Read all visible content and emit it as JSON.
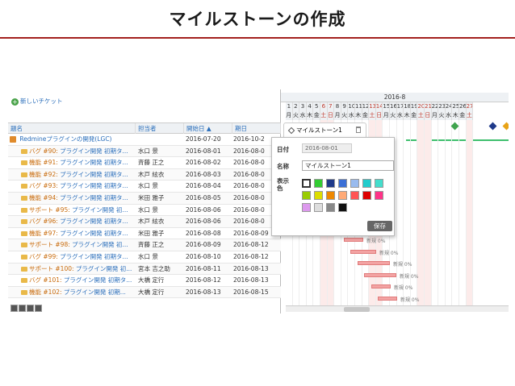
{
  "slide": {
    "title": "マイルストーンの作成"
  },
  "toolbar": {
    "new_ticket": "新しいチケット"
  },
  "table": {
    "headers": {
      "subject": "題名",
      "assignee": "担当者",
      "start": "開始日 ▲",
      "due": "期日"
    },
    "rows": [
      {
        "tracker": "",
        "subject": "Redmineプラグインの開発(LGC)",
        "assignee": "",
        "start": "2016-07-20",
        "due": "2016-10-2"
      },
      {
        "tracker": "バグ #90:",
        "subject": "プラグイン開発 初期タ...",
        "assignee": "水口 景",
        "start": "2016-08-01",
        "due": "2016-08-0"
      },
      {
        "tracker": "機能 #91:",
        "subject": "プラグイン開発 初期タ...",
        "assignee": "斉藤 正之",
        "start": "2016-08-02",
        "due": "2016-08-0"
      },
      {
        "tracker": "機能 #92:",
        "subject": "プラグイン開発 初期タ...",
        "assignee": "木戸 絃衣",
        "start": "2016-08-03",
        "due": "2016-08-0"
      },
      {
        "tracker": "バグ #93:",
        "subject": "プラグイン開発 初期タ...",
        "assignee": "水口 景",
        "start": "2016-08-04",
        "due": "2016-08-0"
      },
      {
        "tracker": "機能 #94:",
        "subject": "プラグイン開発 初期タ...",
        "assignee": "米田 雅子",
        "start": "2016-08-05",
        "due": "2016-08-0"
      },
      {
        "tracker": "サポート #95:",
        "subject": "プラグイン開発 初...",
        "assignee": "水口 景",
        "start": "2016-08-06",
        "due": "2016-08-0"
      },
      {
        "tracker": "バグ #96:",
        "subject": "プラグイン開発 初期タ...",
        "assignee": "木戸 絃衣",
        "start": "2016-08-06",
        "due": "2016-08-0"
      },
      {
        "tracker": "機能 #97:",
        "subject": "プラグイン開発 初期タ...",
        "assignee": "米田 雅子",
        "start": "2016-08-08",
        "due": "2016-08-09"
      },
      {
        "tracker": "サポート #98:",
        "subject": "プラグイン開発 初...",
        "assignee": "斉藤 正之",
        "start": "2016-08-09",
        "due": "2016-08-12"
      },
      {
        "tracker": "バグ #99:",
        "subject": "プラグイン開発 初期タ...",
        "assignee": "水口 景",
        "start": "2016-08-10",
        "due": "2016-08-12"
      },
      {
        "tracker": "サポート #100:",
        "subject": "プラグイン開発 初...",
        "assignee": "宮本 吉之助",
        "start": "2016-08-11",
        "due": "2016-08-13"
      },
      {
        "tracker": "バグ #101:",
        "subject": "プラグイン開発 初期タ...",
        "assignee": "大橋 定行",
        "start": "2016-08-12",
        "due": "2016-08-13"
      },
      {
        "tracker": "機能 #102:",
        "subject": "プラグイン開発 初期...",
        "assignee": "大橋 定行",
        "start": "2016-08-13",
        "due": "2016-08-15"
      }
    ]
  },
  "gantt": {
    "month": "2016-8",
    "days": [
      "1",
      "2",
      "3",
      "4",
      "5",
      "6",
      "7",
      "8",
      "9",
      "10",
      "11",
      "12",
      "13",
      "14",
      "15",
      "16",
      "17",
      "18",
      "19",
      "20",
      "21",
      "22",
      "23",
      "24",
      "25",
      "26",
      "27"
    ],
    "day_names": [
      "月",
      "火",
      "水",
      "木",
      "金",
      "土",
      "日",
      "月",
      "火",
      "水",
      "木",
      "金",
      "土",
      "日",
      "月",
      "火",
      "水",
      "木",
      "金",
      "土",
      "日",
      "月",
      "火",
      "水",
      "木",
      "金",
      "土"
    ],
    "progress_label": "新規 0%",
    "milestone_colors": [
      "#3fa34d",
      "#1f3a8a",
      "#e8a317"
    ]
  },
  "popup": {
    "tab_label": "マイルストーン1",
    "date_label": "日付",
    "date_value": "2016-08-01",
    "name_label": "名称",
    "name_value": "マイルストーン1",
    "display_label": "表示色",
    "colors": [
      "#ffffff",
      "#33cc33",
      "#1f3a8a",
      "#3b6fd6",
      "#99bbee",
      "#22cccc",
      "#44ddcc",
      "#99cc00",
      "#dddd00",
      "#ee8800",
      "#ffaa77",
      "#ff5555",
      "#dd0000",
      "#ff3388",
      "#dd99ee",
      "#dddddd",
      "#888888",
      "#111111"
    ],
    "save_label": "保存"
  }
}
